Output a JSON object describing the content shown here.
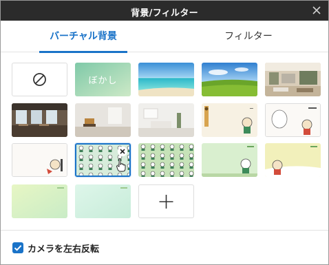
{
  "window": {
    "title": "背景/フィルター"
  },
  "tabs": [
    {
      "label": "バーチャル背景",
      "active": true
    },
    {
      "label": "フィルター",
      "active": false
    }
  ],
  "backgrounds": {
    "none_icon": "prohibited-icon",
    "blur_label": "ぼかし",
    "add_icon": "plus-icon",
    "selected_index": 11
  },
  "footer": {
    "mirror_label": "カメラを左右反転",
    "mirror_checked": true
  },
  "colors": {
    "accent": "#1a73c8",
    "titlebar": "#2b2b2b"
  }
}
